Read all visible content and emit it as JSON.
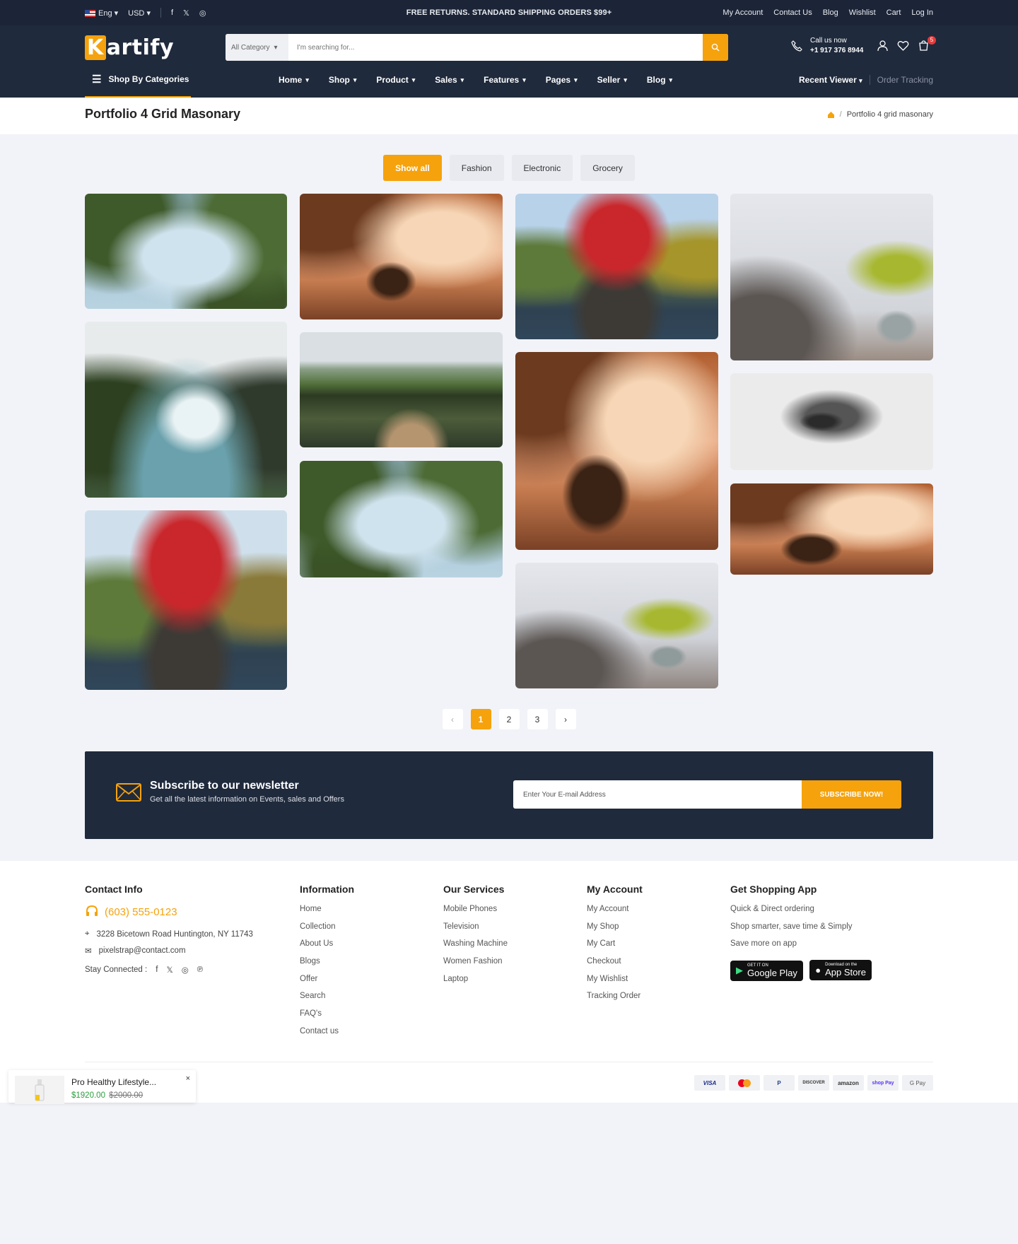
{
  "topbar": {
    "lang": "Eng",
    "currency": "USD",
    "announcement": "FREE RETURNS. STANDARD SHIPPING ORDERS $99+",
    "links": [
      "My Account",
      "Contact Us",
      "Blog",
      "Wishlist",
      "Cart",
      "Log In"
    ]
  },
  "header": {
    "logo_first": "K",
    "logo_rest": "artify",
    "search_category": "All Category",
    "search_placeholder": "I'm searching for...",
    "call_label": "Call us now",
    "call_number": "+1 917 376 8944",
    "cart_count": "5"
  },
  "nav": {
    "shop_by": "Shop By Categories",
    "items": [
      "Home",
      "Shop",
      "Product",
      "Sales",
      "Features",
      "Pages",
      "Seller",
      "Blog"
    ],
    "recent": "Recent Viewer",
    "tracking": "Order Tracking"
  },
  "page": {
    "title": "Portfolio 4 Grid Masonary",
    "breadcrumb": "Portfolio 4 grid masonary"
  },
  "filters": [
    "Show all",
    "Fashion",
    "Electronic",
    "Grocery"
  ],
  "pagination": {
    "prev": "‹",
    "pages": [
      "1",
      "2",
      "3"
    ],
    "next": "›",
    "current": "1"
  },
  "newsletter": {
    "title": "Subscribe to our newsletter",
    "subtitle": "Get all the latest information on Events, sales and Offers",
    "placeholder": "Enter Your E-mail Address",
    "button": "SUBSCRIBE NOW!"
  },
  "footer": {
    "contact": {
      "title": "Contact Info",
      "phone": "(603) 555-0123",
      "address": "3228 Bicetown Road Huntington, NY 11743",
      "email": "pixelstrap@contact.com",
      "stay": "Stay Connected :"
    },
    "information": {
      "title": "Information",
      "items": [
        "Home",
        "Collection",
        "About Us",
        "Blogs",
        "Offer",
        "Search",
        "FAQ's",
        "Contact us"
      ]
    },
    "services": {
      "title": "Our Services",
      "items": [
        "Mobile Phones",
        "Television",
        "Washing Machine",
        "Women Fashion",
        "Laptop"
      ]
    },
    "account": {
      "title": "My Account",
      "items": [
        "My Account",
        "My Shop",
        "My Cart",
        "Checkout",
        "My Wishlist",
        "Tracking Order"
      ]
    },
    "app": {
      "title": "Get Shopping App",
      "items": [
        "Quick & Direct ordering",
        "Shop smarter, save time & Simply",
        "Save more on app"
      ],
      "google_small": "GET IT ON",
      "google": "Google Play",
      "apple_small": "Download on the",
      "apple": "App Store"
    },
    "payments": [
      "VISA",
      "MC",
      "P",
      "DISCOVER",
      "amazon",
      "shop Pay",
      "G Pay"
    ]
  },
  "popup": {
    "name": "Pro Healthy Lifestyle...",
    "price": "$1920.00",
    "old_price": "$2000.00",
    "close": "×"
  },
  "colors": {
    "accent": "#f5a20c",
    "dark": "#1f2a3c",
    "topbar": "#1c2537"
  }
}
